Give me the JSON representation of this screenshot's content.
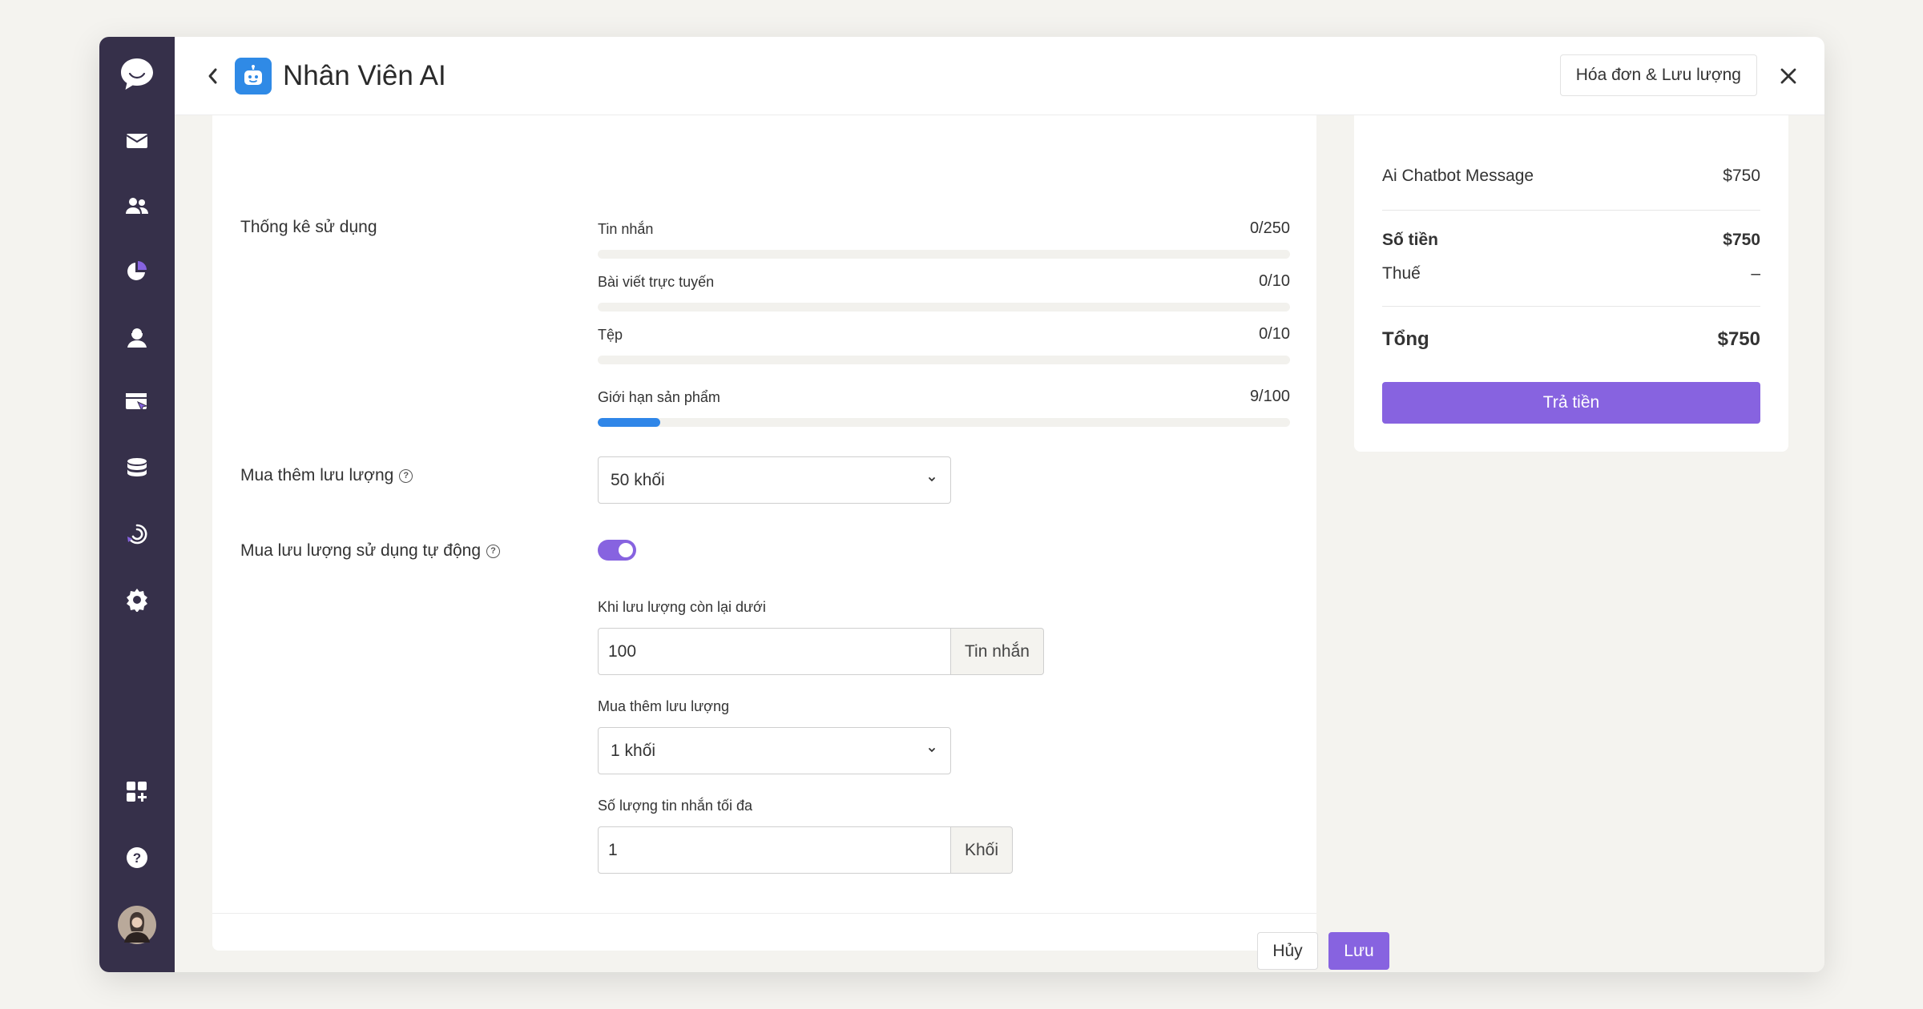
{
  "header": {
    "title": "Nhân Viên AI",
    "invoice_button": "Hóa đơn & Lưu lượng"
  },
  "sidebar": {
    "icons": [
      "chat-bubble-icon",
      "inbox-icon",
      "contacts-icon",
      "reports-icon",
      "agent-icon",
      "campaigns-icon",
      "database-icon",
      "integrations-icon",
      "settings-icon",
      "apps-icon",
      "help-icon",
      "avatar"
    ]
  },
  "usage": {
    "section_label": "Thống kê sử dụng",
    "items": [
      {
        "label": "Tin nhắn",
        "value": "0/250",
        "fraction": 0.0
      },
      {
        "label": "Bài viết trực tuyến",
        "value": "0/10",
        "fraction": 0.0
      },
      {
        "label": "Tệp",
        "value": "0/10",
        "fraction": 0.0
      },
      {
        "label": "Giới hạn sản phẩm",
        "value": "9/100",
        "fraction": 0.09
      }
    ]
  },
  "purchase": {
    "label": "Mua thêm lưu lượng",
    "selected": "50 khối"
  },
  "auto_purchase": {
    "label": "Mua lưu lượng sử dụng tự động",
    "enabled": true,
    "threshold_label": "Khi lưu lượng còn lại dưới",
    "threshold_value": "100",
    "threshold_unit": "Tin nhắn",
    "extra_label": "Mua thêm lưu lượng",
    "extra_selected": "1 khối",
    "max_label": "Số lượng tin nhắn tối đa",
    "max_value": "1",
    "max_unit": "Khối"
  },
  "actions": {
    "cancel": "Hủy",
    "save": "Lưu"
  },
  "summary": {
    "item_label": "Ai Chatbot Message",
    "item_price": "$750",
    "amount_label": "Số tiền",
    "amount_value": "$750",
    "tax_label": "Thuế",
    "tax_value": "–",
    "total_label": "Tổng",
    "total_value": "$750",
    "pay_button": "Trả tiền"
  },
  "colors": {
    "sidebar": "#36304a",
    "accent": "#8763e0",
    "progress": "#2f86e8",
    "bot_logo": "#2f8ae6"
  }
}
